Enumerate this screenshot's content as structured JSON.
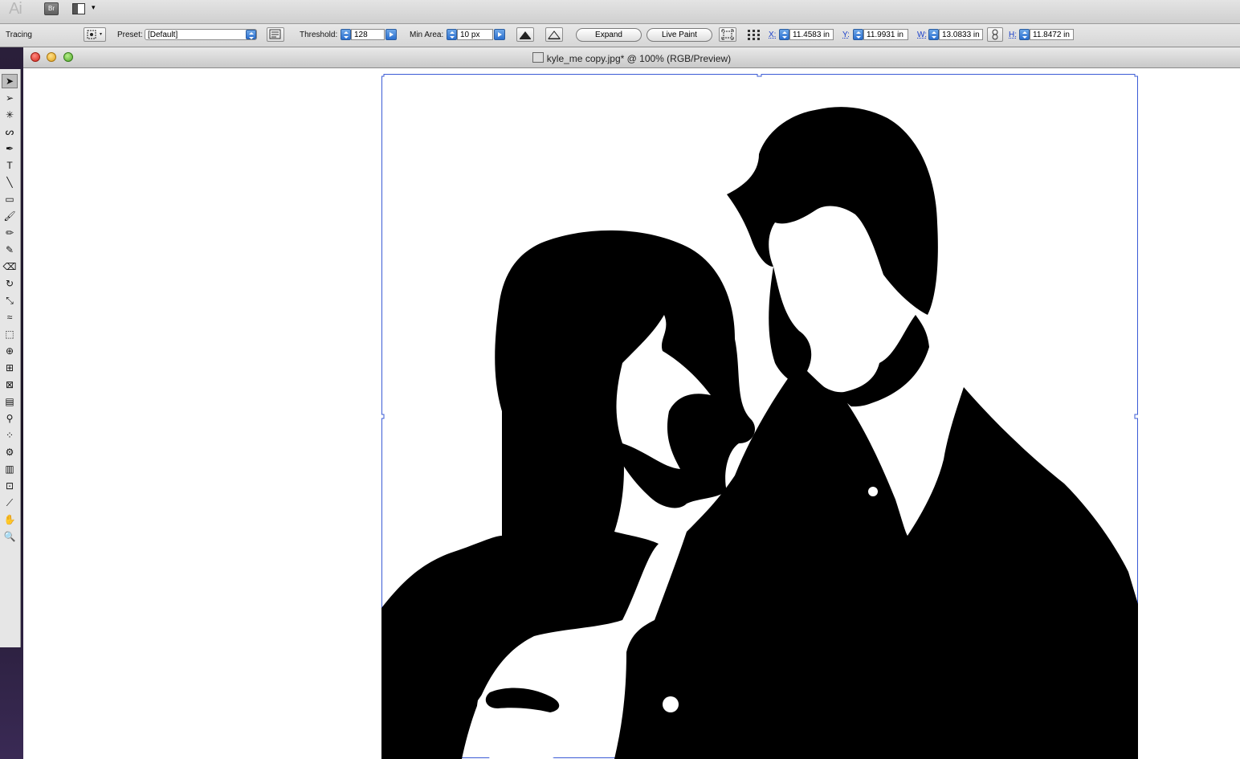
{
  "app": {
    "logo": "Ai",
    "bridge_label": "Br",
    "arrange_caret": "▾"
  },
  "control": {
    "mode_label": "Tracing",
    "preset_label": "Preset:",
    "preset_value": "[Default]",
    "threshold_label": "Threshold:",
    "threshold_value": "128",
    "min_area_label": "Min Area:",
    "min_area_value": "10 px",
    "expand_label": "Expand",
    "live_paint_label": "Live Paint",
    "x_label": "X:",
    "x_value": "11.4583 in",
    "y_label": "Y:",
    "y_value": "11.9931 in",
    "w_label": "W:",
    "w_value": "13.0833 in",
    "h_label": "H:",
    "h_value": "11.8472 in"
  },
  "document": {
    "title": "kyle_me copy.jpg* @ 100% (RGB/Preview)",
    "selection_color": "#3b5bd6"
  },
  "tools": [
    {
      "name": "selection-tool-icon",
      "glyph": "➤"
    },
    {
      "name": "direct-selection-tool-icon",
      "glyph": "➢"
    },
    {
      "name": "magic-wand-tool-icon",
      "glyph": "✳"
    },
    {
      "name": "lasso-tool-icon",
      "glyph": "ᔕ"
    },
    {
      "name": "pen-tool-icon",
      "glyph": "✒"
    },
    {
      "name": "type-tool-icon",
      "glyph": "T"
    },
    {
      "name": "line-segment-tool-icon",
      "glyph": "╲"
    },
    {
      "name": "rectangle-tool-icon",
      "glyph": "▭"
    },
    {
      "name": "paintbrush-tool-icon",
      "glyph": "🖌"
    },
    {
      "name": "pencil-tool-icon",
      "glyph": "✏"
    },
    {
      "name": "blob-brush-tool-icon",
      "glyph": "✎"
    },
    {
      "name": "eraser-tool-icon",
      "glyph": "⌫"
    },
    {
      "name": "rotate-tool-icon",
      "glyph": "↻"
    },
    {
      "name": "scale-tool-icon",
      "glyph": "⤡"
    },
    {
      "name": "warp-tool-icon",
      "glyph": "≈"
    },
    {
      "name": "free-transform-tool-icon",
      "glyph": "⬚"
    },
    {
      "name": "shape-builder-tool-icon",
      "glyph": "⊕"
    },
    {
      "name": "perspective-grid-tool-icon",
      "glyph": "⊞"
    },
    {
      "name": "mesh-tool-icon",
      "glyph": "⊠"
    },
    {
      "name": "gradient-tool-icon",
      "glyph": "▤"
    },
    {
      "name": "eyedropper-tool-icon",
      "glyph": "⚲"
    },
    {
      "name": "blend-tool-icon",
      "glyph": "⁘"
    },
    {
      "name": "symbol-sprayer-tool-icon",
      "glyph": "⚙"
    },
    {
      "name": "column-graph-tool-icon",
      "glyph": "▥"
    },
    {
      "name": "artboard-tool-icon",
      "glyph": "⊡"
    },
    {
      "name": "slice-tool-icon",
      "glyph": "⟋"
    },
    {
      "name": "hand-tool-icon",
      "glyph": "✋"
    },
    {
      "name": "zoom-tool-icon",
      "glyph": "🔍"
    }
  ]
}
